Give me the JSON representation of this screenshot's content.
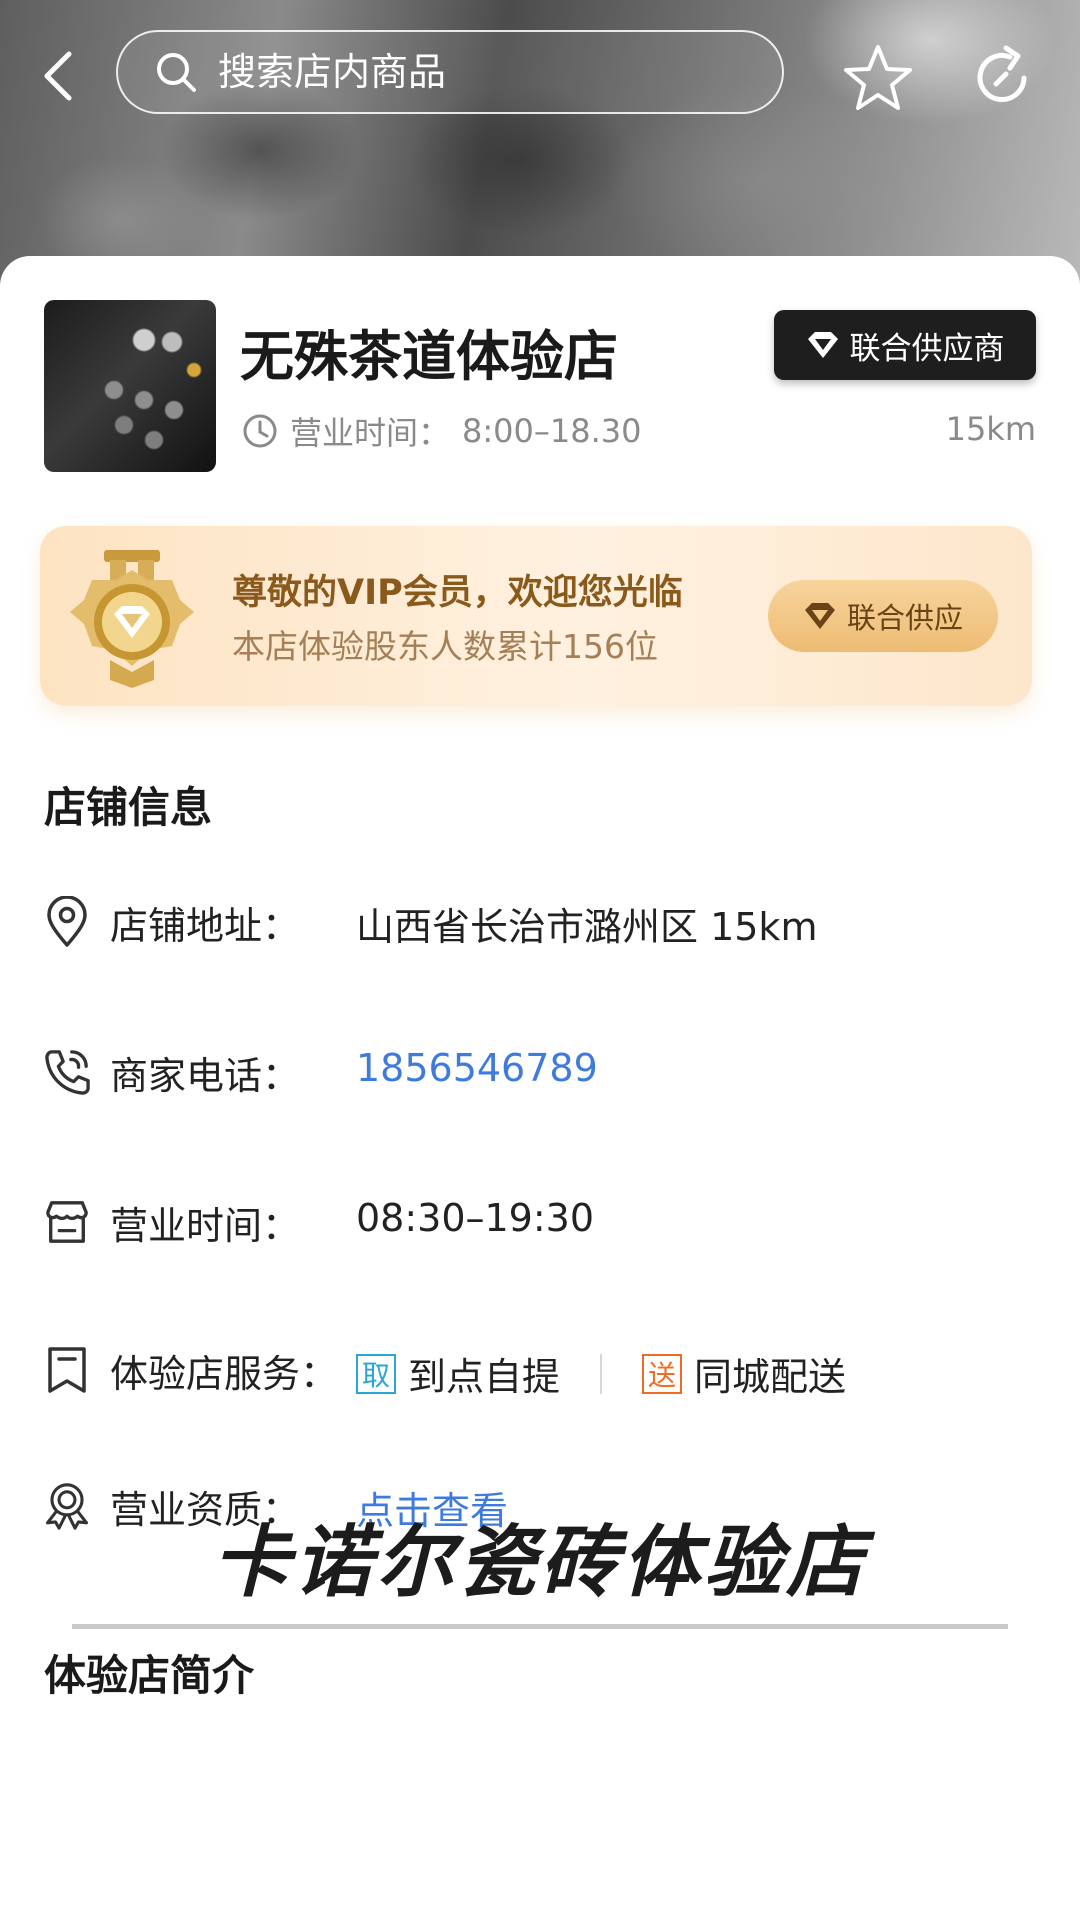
{
  "header": {
    "search_placeholder": "搜索店内商品",
    "icons": [
      "back-arrow-icon",
      "search-icon",
      "star-icon",
      "refresh-icon"
    ]
  },
  "store": {
    "name": "无殊茶道体验店",
    "badge": "联合供应商",
    "hours_label": "营业时间：",
    "hours_value": "8:00–18.30",
    "distance": "15km"
  },
  "vip": {
    "title": "尊敬的VIP会员，欢迎您光临",
    "subtitle": "本店体验股东人数累计156位",
    "button": "联合供应"
  },
  "store_info": {
    "title": "店铺信息",
    "address_label": "店铺地址：",
    "address_value": "山西省长治市潞州区 15km",
    "phone_label": "商家电话：",
    "phone_value": "1856546789",
    "hours_label": "营业时间：",
    "hours_value": "08:30–19:30",
    "service_label": "体验店服务：",
    "service_pickup_tag": "取",
    "service_pickup": "到点自提",
    "service_delivery_tag": "送",
    "service_delivery": "同城配送",
    "license_label": "营业资质：",
    "license_value": "点击查看"
  },
  "intro": {
    "title": "体验店简介",
    "banner": "卡诺尔瓷砖体验店"
  },
  "colors": {
    "link": "#3f7bdc",
    "vip_gold": "#8a5a1c",
    "tag_blue": "#26a7d8",
    "tag_orange": "#f06b24"
  }
}
